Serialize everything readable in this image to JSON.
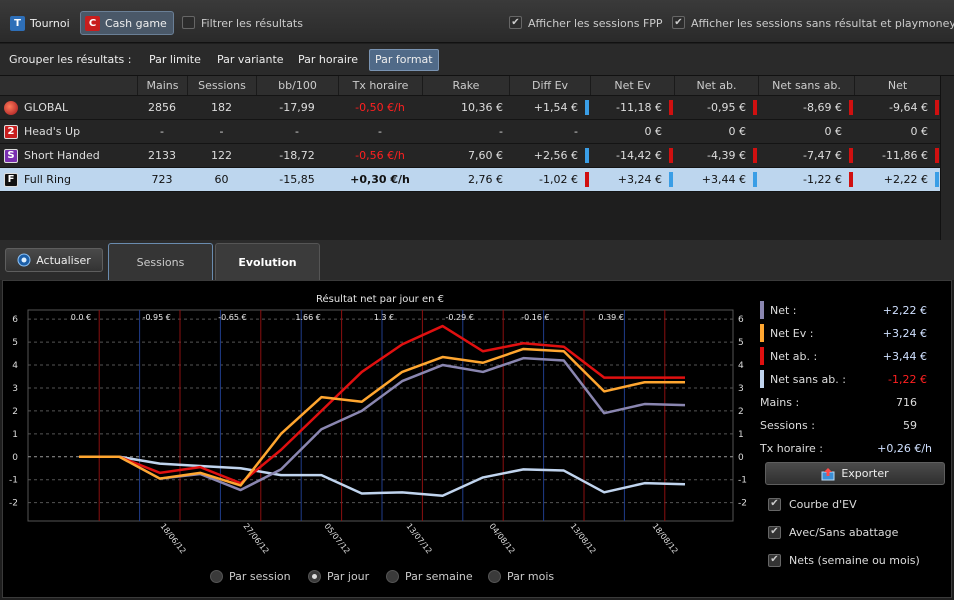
{
  "topbar": {
    "tab_tournoi": {
      "badge": "T",
      "label": "Tournoi"
    },
    "tab_cash": {
      "badge": "C",
      "label": "Cash game"
    },
    "filter_label": "Filtrer les résultats",
    "fpp_label": "Afficher les sessions FPP",
    "playmoney_label": "Afficher les sessions sans résultat et playmoney"
  },
  "group": {
    "label": "Grouper les résultats :",
    "buttons": [
      "Par limite",
      "Par variante",
      "Par horaire",
      "Par format"
    ],
    "active": "Par format"
  },
  "table": {
    "headers": [
      "Mains",
      "Sessions",
      "bb/100",
      "Tx horaire",
      "Rake",
      "Diff Ev",
      "Net Ev",
      "Net ab.",
      "Net sans ab.",
      "Net"
    ],
    "rows": [
      {
        "icon": "globe-icon",
        "badge": "",
        "name": "GLOBAL",
        "mains": "2856",
        "sessions": "182",
        "bb100": "-17,99",
        "tx": "-0,50 €/h",
        "rake": "10,36 €",
        "diff_ev": "+1,54 €",
        "net_ev": "-11,18 €",
        "net_ab": "-0,95 €",
        "net_sans_ab": "-8,69 €",
        "net": "-9,64 €"
      },
      {
        "icon": "heads-up-icon",
        "badge": "2",
        "name": "Head's Up",
        "mains": "-",
        "sessions": "-",
        "bb100": "-",
        "tx": "-",
        "rake": "-",
        "diff_ev": "-",
        "net_ev": "0 €",
        "net_ab": "0 €",
        "net_sans_ab": "0 €",
        "net": "0 €"
      },
      {
        "icon": "short-handed-icon",
        "badge": "S",
        "name": "Short Handed",
        "mains": "2133",
        "sessions": "122",
        "bb100": "-18,72",
        "tx": "-0,56 €/h",
        "rake": "7,60 €",
        "diff_ev": "+2,56 €",
        "net_ev": "-14,42 €",
        "net_ab": "-4,39 €",
        "net_sans_ab": "-7,47 €",
        "net": "-11,86 €"
      },
      {
        "icon": "full-ring-icon",
        "badge": "F",
        "name": "Full Ring",
        "mains": "723",
        "sessions": "60",
        "bb100": "-15,85",
        "tx": "+0,30 €/h",
        "rake": "2,76 €",
        "diff_ev": "-1,02 €",
        "net_ev": "+3,24 €",
        "net_ab": "+3,44 €",
        "net_sans_ab": "-1,22 €",
        "net": "+2,22 €"
      }
    ]
  },
  "tabs": {
    "refresh": "Actualiser",
    "sessions": "Sessions",
    "evolution": "Evolution"
  },
  "legend": {
    "net": {
      "label": "Net :",
      "value": "+2,22 €"
    },
    "net_ev": {
      "label": "Net Ev :",
      "value": "+3,24 €"
    },
    "net_ab": {
      "label": "Net ab. :",
      "value": "+3,44 €"
    },
    "net_sans_ab": {
      "label": "Net sans ab. :",
      "value": "-1,22 €"
    },
    "mains": {
      "label": "Mains :",
      "value": "716"
    },
    "sessions": {
      "label": "Sessions :",
      "value": "59"
    },
    "tx": {
      "label": "Tx horaire :",
      "value": "+0,26 €/h"
    }
  },
  "export_label": "Exporter",
  "options": [
    "Courbe d'EV",
    "Avec/Sans abattage",
    "Nets (semaine ou mois)"
  ],
  "radios": [
    "Par session",
    "Par jour",
    "Par semaine",
    "Par mois"
  ],
  "radio_selected": "Par jour",
  "colors": {
    "net": "#8a86b0",
    "net_ev": "#ffa630",
    "net_ab": "#e01010",
    "net_sans_ab": "#c0d4ee",
    "positive_bar": "#3a9ee6",
    "negative_bar": "#d01010"
  },
  "chart_data": {
    "type": "line",
    "title": "Résultat net par jour en €",
    "ylim": [
      -2.8,
      6.4
    ],
    "yticks": [
      -2,
      -1,
      0,
      1,
      2,
      3,
      4,
      5,
      6
    ],
    "x_ticks": [
      "18/06/12",
      "27/06/12",
      "05/07/12",
      "13/07/12",
      "04/08/12",
      "13/08/12",
      "18/08/12"
    ],
    "weekly_nets": [
      "0.0 €",
      "-0.95 €",
      "-0.65 €",
      "1.66 €",
      "1.3 €",
      "-0.29 €",
      "-0.16 €",
      "0.39 €"
    ],
    "series": [
      {
        "name": "Net sans ab.",
        "key": "net_sans_ab",
        "values": [
          0,
          0,
          -0.3,
          -0.4,
          -0.5,
          -0.8,
          -0.8,
          -1.6,
          -1.55,
          -1.7,
          -0.9,
          -0.55,
          -0.6,
          -1.55,
          -1.15,
          -1.2
        ]
      },
      {
        "name": "Net",
        "key": "net",
        "values": [
          0,
          0,
          -0.95,
          -0.75,
          -1.45,
          -0.55,
          1.2,
          2.0,
          3.3,
          4.0,
          3.7,
          4.3,
          4.2,
          1.9,
          2.3,
          2.25
        ]
      },
      {
        "name": "Net ab.",
        "key": "net_ab",
        "values": [
          0,
          0,
          -0.7,
          -0.45,
          -1.15,
          0.3,
          2.0,
          3.7,
          4.9,
          5.7,
          4.6,
          4.95,
          4.8,
          3.45,
          3.45,
          3.45
        ]
      },
      {
        "name": "Net Ev",
        "key": "net_ev",
        "values": [
          0,
          0,
          -0.95,
          -0.7,
          -1.25,
          1.0,
          2.6,
          2.4,
          3.7,
          4.35,
          4.1,
          4.7,
          4.6,
          2.85,
          3.25,
          3.25
        ]
      }
    ]
  }
}
